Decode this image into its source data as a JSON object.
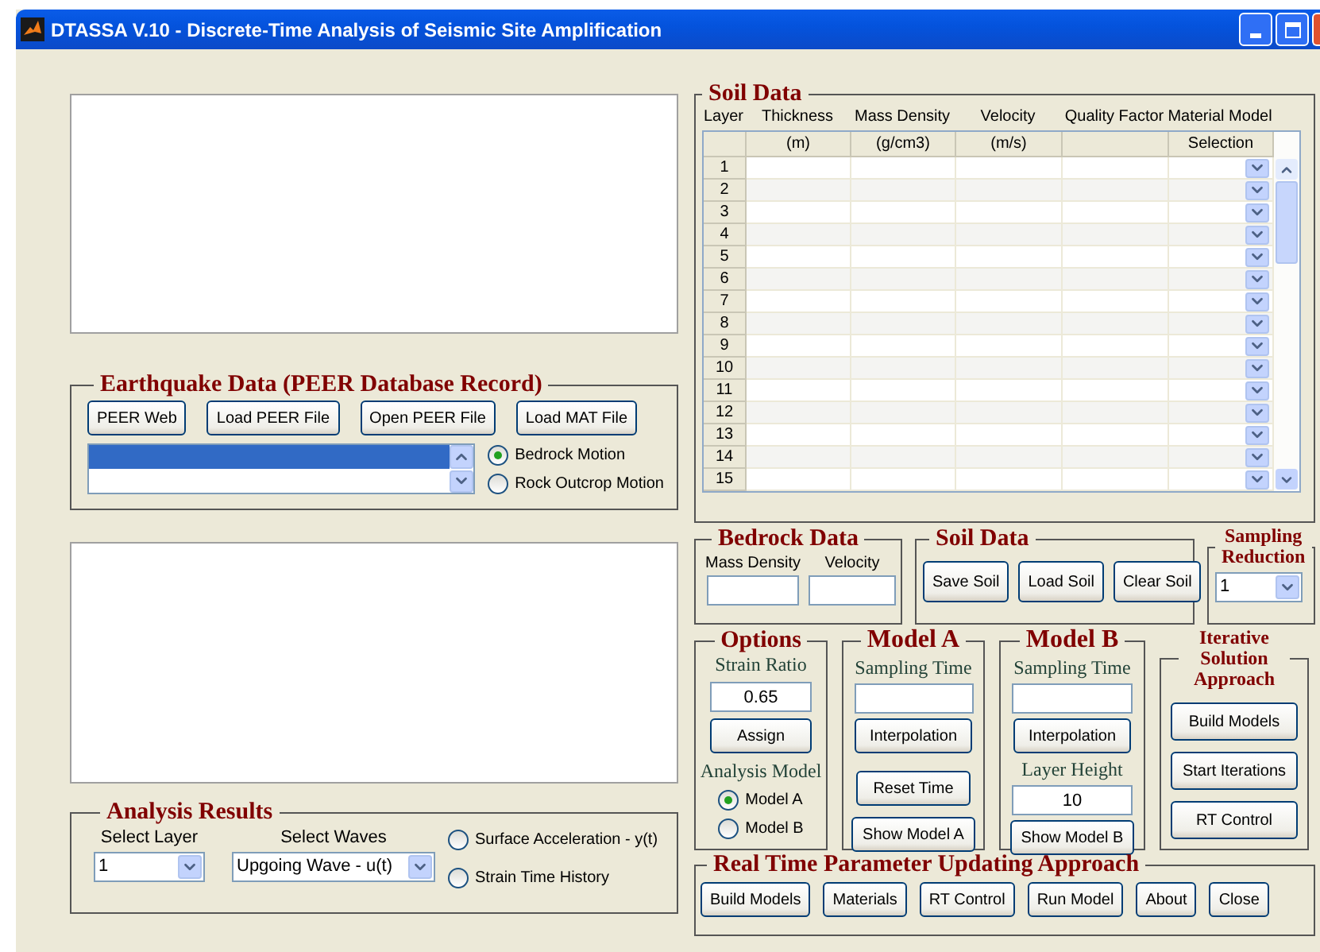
{
  "window": {
    "title": "DTASSA V.10 - Discrete-Time Analysis of Seismic Site Amplification"
  },
  "earthquake_data": {
    "title": "Earthquake Data (PEER Database Record)",
    "buttons": [
      "PEER Web",
      "Load PEER File",
      "Open PEER File",
      "Load MAT File"
    ],
    "records": [
      {
        "selected": true
      },
      {
        "selected": false
      }
    ],
    "motions": [
      {
        "label": "Bedrock Motion",
        "selected": true
      },
      {
        "label": "Rock Outcrop Motion",
        "selected": false
      }
    ]
  },
  "analysis_results": {
    "title": "Analysis Results",
    "layer_label": "Select Layer",
    "layer_value": "1",
    "waves_label": "Select Waves",
    "waves_value": "Upgoing Wave - u(t)",
    "outputs": [
      {
        "label": "Surface Acceleration - y(t)",
        "selected": false
      },
      {
        "label": "Strain Time History",
        "selected": false
      }
    ]
  },
  "soil_data": {
    "title": "Soil Data",
    "columns": [
      {
        "label": "Layer"
      },
      {
        "label": "Thickness",
        "unit": "(m)"
      },
      {
        "label": "Mass Density",
        "unit": "(g/cm3)"
      },
      {
        "label": "Velocity",
        "unit": "(m/s)"
      },
      {
        "label": "Quality Factor"
      },
      {
        "label": "Material Model",
        "unit": "Selection"
      }
    ],
    "rows": [
      {
        "layer": "1"
      },
      {
        "layer": "2"
      },
      {
        "layer": "3"
      },
      {
        "layer": "4"
      },
      {
        "layer": "5"
      },
      {
        "layer": "6"
      },
      {
        "layer": "7"
      },
      {
        "layer": "8"
      },
      {
        "layer": "9"
      },
      {
        "layer": "10"
      },
      {
        "layer": "11"
      },
      {
        "layer": "12"
      },
      {
        "layer": "13"
      },
      {
        "layer": "14"
      },
      {
        "layer": "15"
      }
    ]
  },
  "bedrock_data": {
    "title": "Bedrock Data",
    "fields": [
      {
        "label": "Mass Density"
      },
      {
        "label": "Velocity"
      }
    ]
  },
  "soil_files": {
    "title": "Soil Data",
    "buttons": [
      "Save Soil",
      "Load Soil",
      "Clear Soil"
    ]
  },
  "sampling_reduction": {
    "title": "Sampling Reduction",
    "value": "1"
  },
  "options": {
    "title": "Options",
    "strain_ratio_label": "Strain Ratio",
    "strain_ratio_value": "0.65",
    "assign": "Assign",
    "analysis_model_label": "Analysis Model",
    "models": [
      {
        "label": "Model A",
        "selected": true
      },
      {
        "label": "Model B",
        "selected": false
      }
    ]
  },
  "model_a": {
    "title": "Model A",
    "sampling_time_label": "Sampling Time",
    "buttons": [
      "Interpolation",
      "Reset Time",
      "Show Model A"
    ]
  },
  "model_b": {
    "title": "Model B",
    "sampling_time_label": "Sampling Time",
    "interpolation": "Interpolation",
    "layer_height_label": "Layer Height",
    "layer_height_value": "10",
    "show": "Show Model B"
  },
  "iterative": {
    "title": "Iterative Solution Approach",
    "buttons": [
      "Build Models",
      "Start Iterations",
      "RT Control"
    ]
  },
  "real_time": {
    "title": "Real Time Parameter Updating Approach",
    "buttons": [
      "Build Models",
      "Materials",
      "RT Control",
      "Run Model",
      "About",
      "Close"
    ]
  }
}
